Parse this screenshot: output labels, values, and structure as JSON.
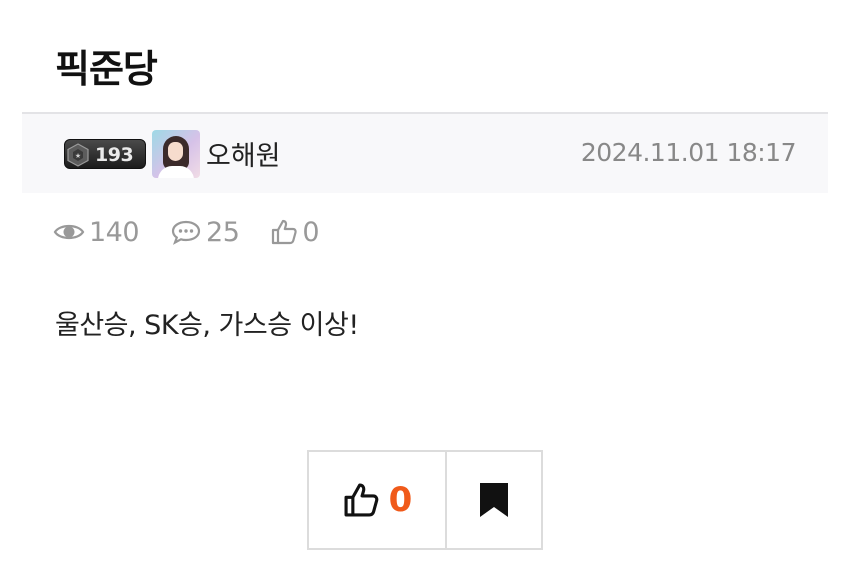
{
  "board": {
    "title": "픽준당"
  },
  "author": {
    "level": "193",
    "name": "오해원"
  },
  "post": {
    "date": "2024.11.01 18:17",
    "views": "140",
    "comments": "25",
    "likes_stat": "0",
    "body": "울산승, SK승, 가스승 이상!"
  },
  "actions": {
    "like_count": "0"
  },
  "colors": {
    "like_count": "#f05a1a",
    "meta_bg": "#f8f8fa",
    "muted_text": "#999999"
  },
  "icons": {
    "views": "eye-icon",
    "comments": "speech-bubble-icon",
    "likes": "thumbs-up-icon",
    "bookmark": "bookmark-icon"
  }
}
